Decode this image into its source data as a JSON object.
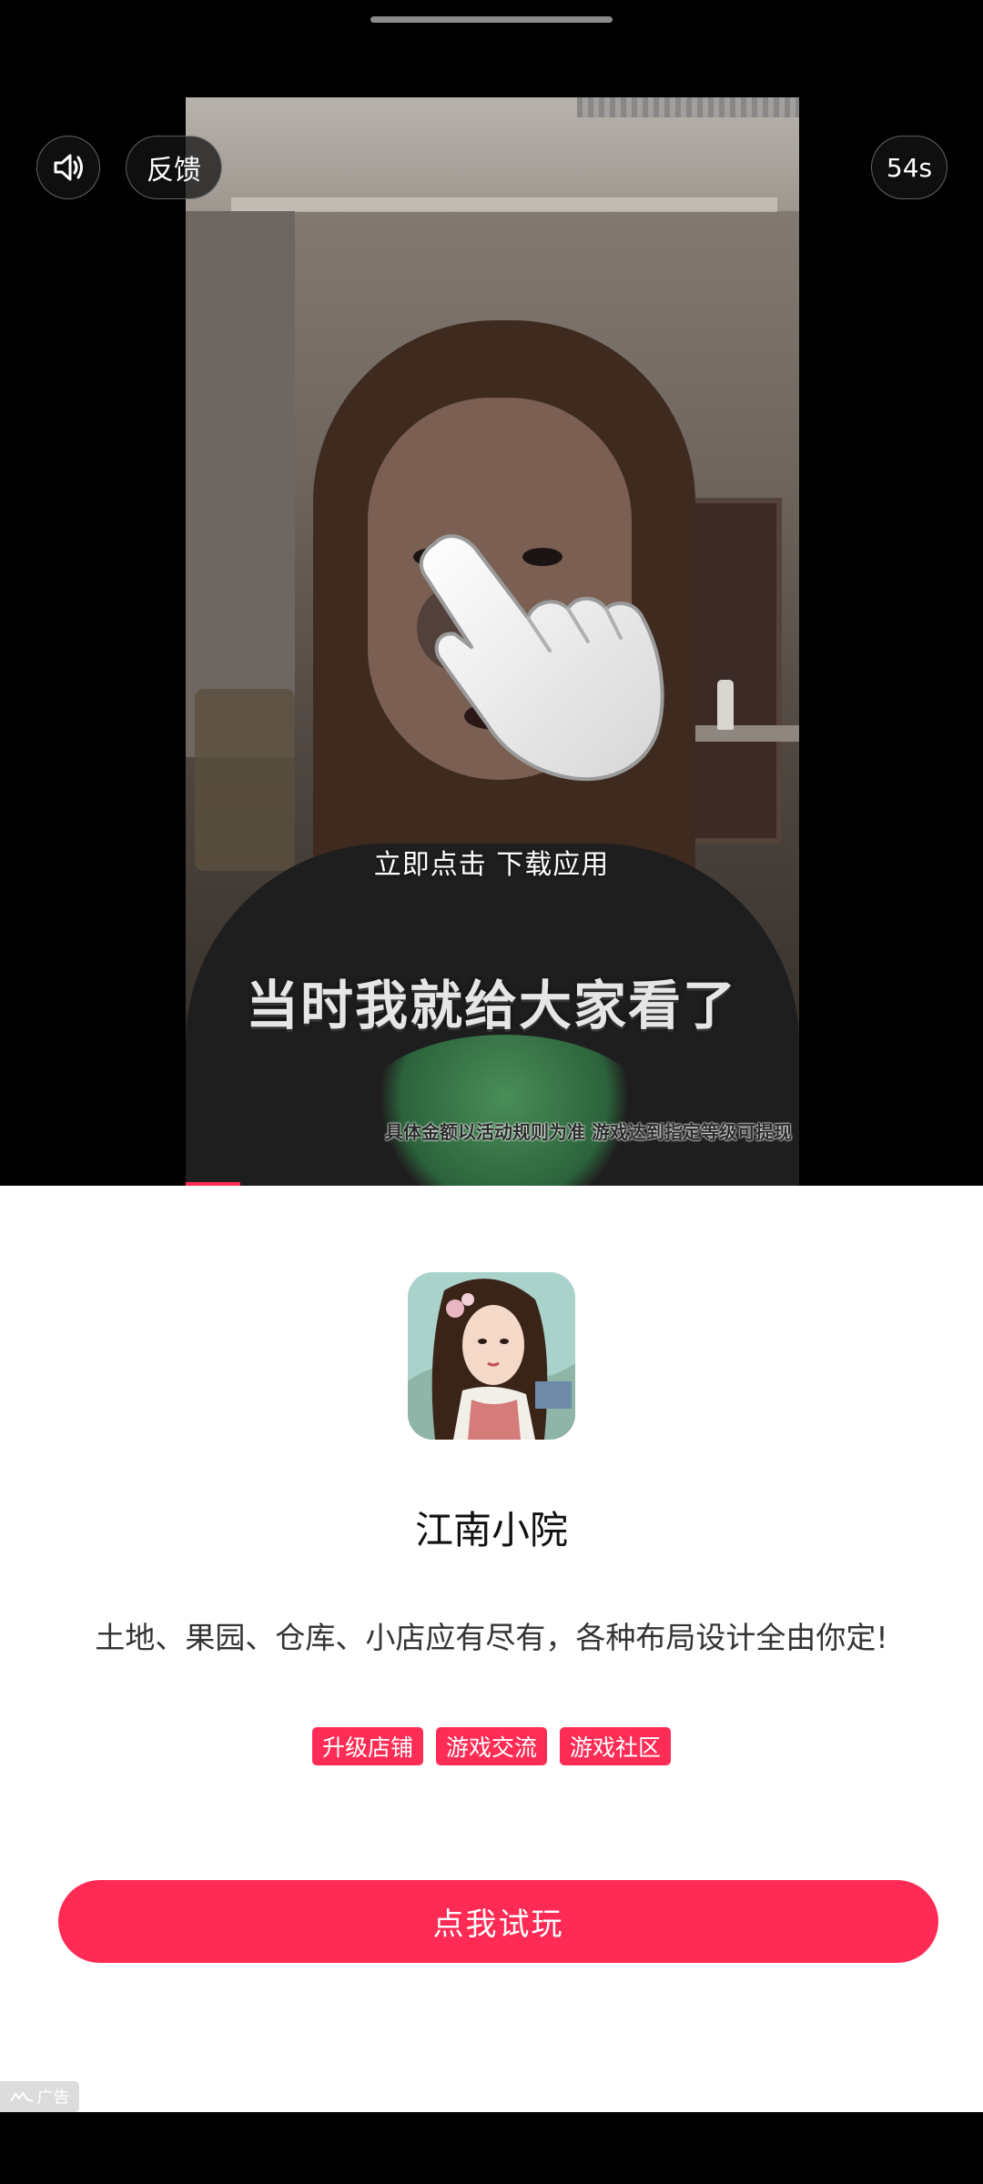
{
  "top_bar": {
    "sound_icon": "speaker-volume-icon",
    "feedback_label": "反馈",
    "timer_label": "54s"
  },
  "video": {
    "cta_text": "立即点击 下载应用",
    "subtitle": "当时我就给大家看了",
    "disclaimer": "具体金额以活动规则为准 游戏达到指定等级可提现",
    "hand_icon": "tap-hand-icon"
  },
  "app": {
    "name": "江南小院",
    "description": "土地、果园、仓库、小店应有尽有，各种布局设计全由你定!",
    "tags": [
      "升级店铺",
      "游戏交流",
      "游戏社区"
    ],
    "play_label": "点我试玩"
  },
  "ad_label": "广告",
  "colors": {
    "accent": "#ff2b55",
    "panel_bg": "#ffffff",
    "screen_bg": "#000000"
  }
}
